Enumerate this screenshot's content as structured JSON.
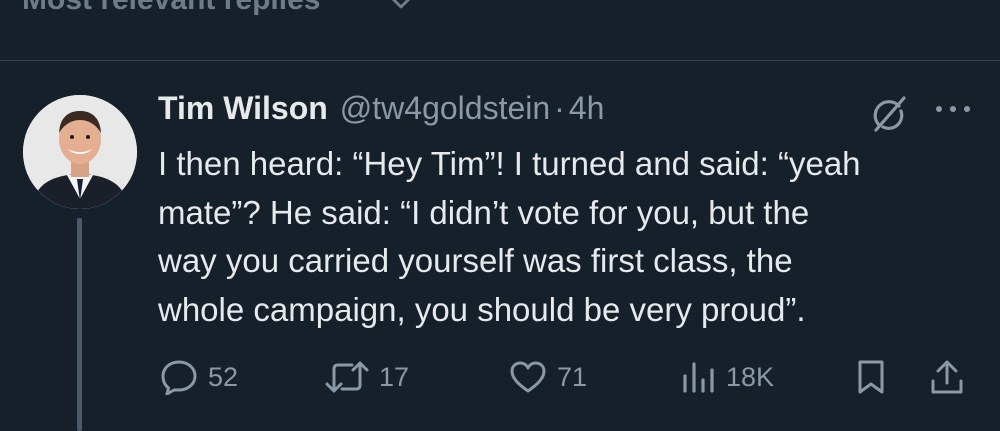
{
  "sort": {
    "label": "Most relevant replies"
  },
  "tweet": {
    "author_name": "Tim Wilson",
    "handle": "@tw4goldstein",
    "separator": "·",
    "time": "4h",
    "text_lines": [
      "I then heard: “Hey Tim”! I turned and said: “yeah",
      "mate”? He said: “I didn’t vote for you, but the",
      "way you carried yourself was first class, the",
      "whole campaign, you should be very proud”."
    ]
  },
  "actions": {
    "replies": "52",
    "reposts": "17",
    "likes": "71",
    "views": "18K"
  },
  "icons": {
    "reply": "speech-bubble",
    "repost": "retweet-arrows",
    "like": "heart",
    "views": "bar-chart",
    "bookmark": "bookmark",
    "share": "upload-arrow",
    "grok": "grok-slash-circle",
    "more": "three-dots"
  },
  "colors": {
    "background": "#15202b",
    "text_primary": "#e7e9ea",
    "text_secondary": "#8b98a5",
    "divider": "#38444d"
  }
}
